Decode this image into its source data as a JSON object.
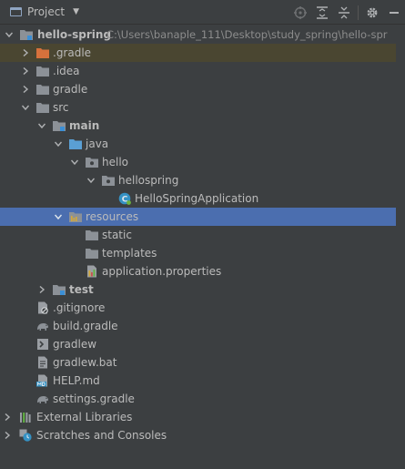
{
  "header": {
    "title": "Project",
    "tools": [
      "locate-icon",
      "expand-all-icon",
      "collapse-all-icon",
      "gear-icon",
      "hide-icon"
    ]
  },
  "tree": {
    "root": {
      "label": "hello-spring",
      "path": "C:\\Users\\banaple_111\\Desktop\\study_spring\\hello-spr"
    },
    "gradle_hidden": ".gradle",
    "idea": ".idea",
    "gradle": "gradle",
    "src": "src",
    "main": "main",
    "java": "java",
    "hello": "hello",
    "hellospring": "hellospring",
    "app_class": "HelloSpringApplication",
    "resources": "resources",
    "static": "static",
    "templates": "templates",
    "app_props": "application.properties",
    "test": "test",
    "gitignore": ".gitignore",
    "build_gradle": "build.gradle",
    "gradlew": "gradlew",
    "gradlew_bat": "gradlew.bat",
    "help_md": "HELP.md",
    "settings_gradle": "settings.gradle",
    "external_libraries": "External Libraries",
    "scratches": "Scratches and Consoles"
  },
  "colors": {
    "background": "#3c3f41",
    "selected": "#4b6eaf",
    "excluded_highlight": "#4a4631",
    "folder": "#8c9197",
    "source_folder": "#5a9fd4",
    "excluded_folder": "#d6713c"
  }
}
